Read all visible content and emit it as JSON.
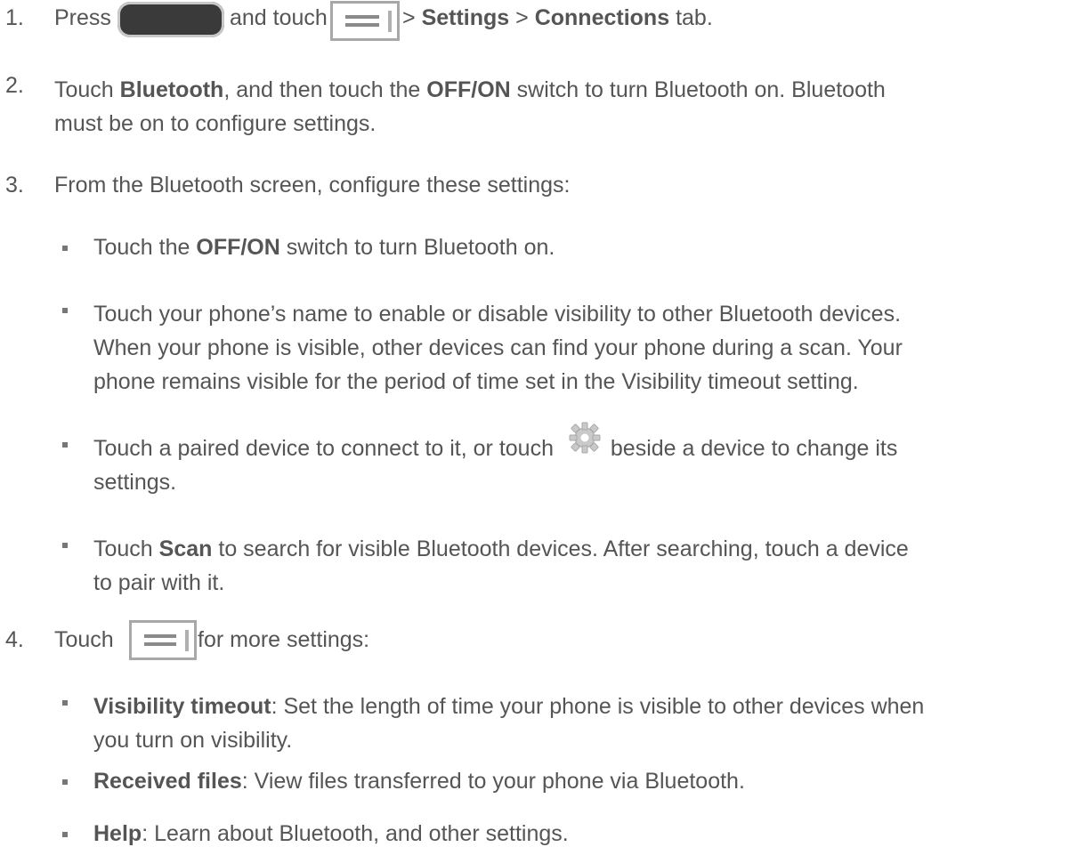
{
  "steps": [
    {
      "number": "1.",
      "prefix": "Press",
      "middle": "and touch",
      "sep1": ">",
      "settings": "Settings",
      "sep2": ">",
      "connections": "Connections",
      "suffix": "tab."
    },
    {
      "number": "2.",
      "t1": "Touch",
      "bluetooth": "Bluetooth",
      "t2": ", and then touch the",
      "offon": "OFF/ON",
      "t3": "switch to turn Bluetooth on. Bluetooth",
      "line2": "must be on to configure settings."
    },
    {
      "number": "3.",
      "text": "From the Bluetooth screen, configure these settings:",
      "bullets": [
        {
          "t1": "Touch the",
          "offon": "OFF/ON",
          "t2": "switch to turn Bluetooth on."
        },
        {
          "line1": "Touch your phone’s name to enable or disable visibility to other Bluetooth devices.",
          "line2": "When your phone is visible, other devices can find your phone during a scan. Your",
          "line3": "phone remains visible for the period of time set in the Visibility timeout setting."
        },
        {
          "t1": "Touch a paired device to connect to it, or touch",
          "t2": "beside a device to change its",
          "line2": "settings."
        },
        {
          "t1": "Touch",
          "scan": "Scan",
          "t2": "to search for visible Bluetooth devices. After searching, touch a device",
          "line2": "to pair with it."
        }
      ]
    },
    {
      "number": "4.",
      "t1": "Touch",
      "t2": "for more settings:",
      "bullets": [
        {
          "term": "Visibility timeout",
          "t1": ": Set the length of time your phone is visible to other devices when",
          "line2": "you turn on visibility."
        },
        {
          "term": "Received files",
          "t1": ": View files transferred to your phone via Bluetooth."
        },
        {
          "term": "Help",
          "t1": ": Learn about Bluetooth, and other settings."
        }
      ]
    }
  ],
  "icons": {
    "home": "home-key-icon",
    "menu": "menu-key-icon",
    "gear": "settings-gear-icon"
  }
}
